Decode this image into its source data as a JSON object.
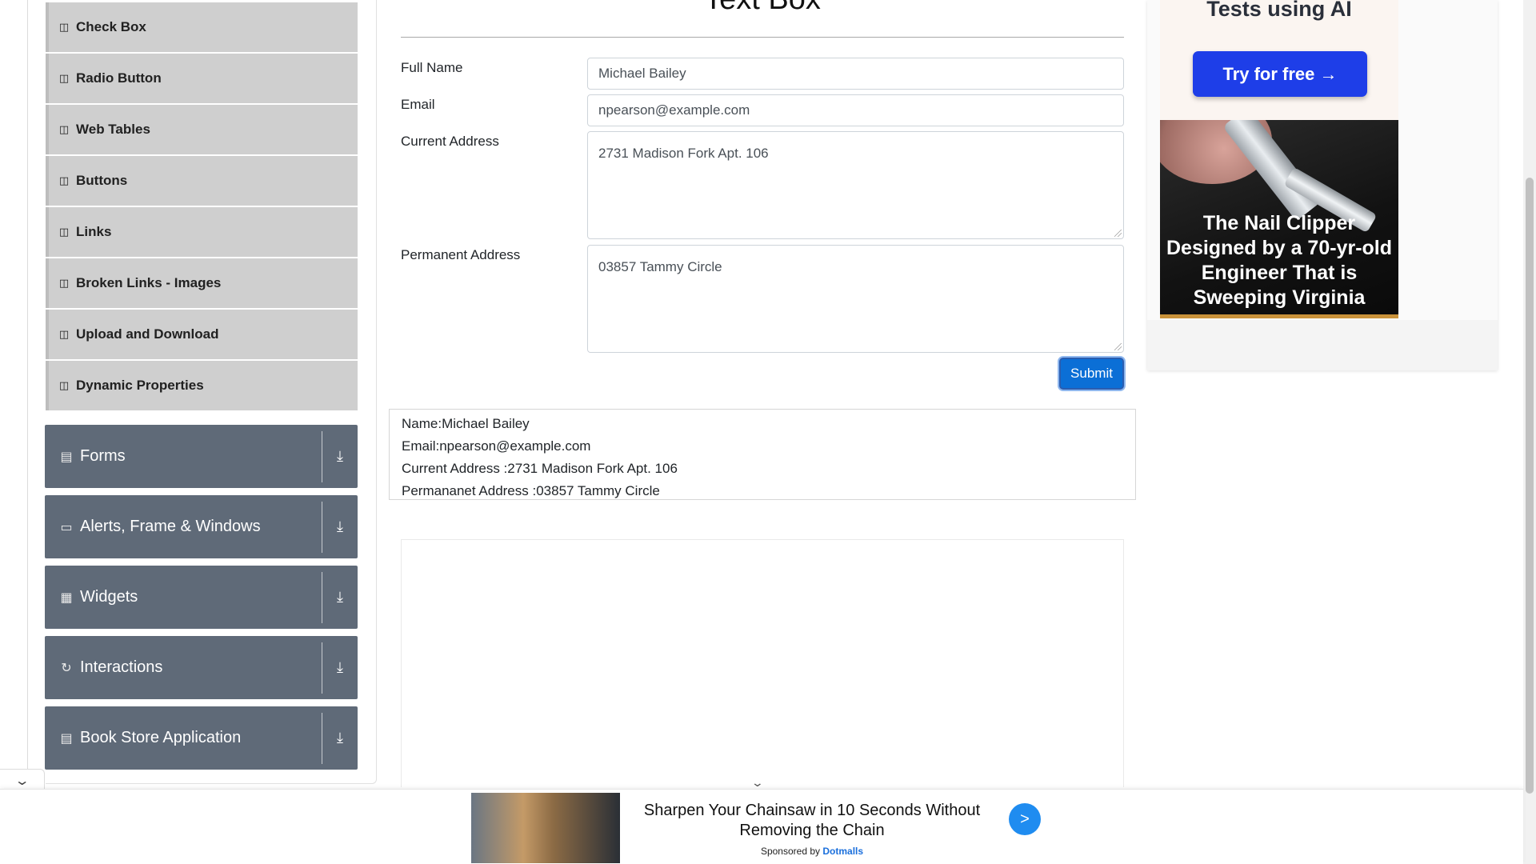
{
  "sidebar": {
    "items": [
      {
        "label": "Check Box",
        "icon": "list-icon"
      },
      {
        "label": "Radio Button",
        "icon": "list-icon"
      },
      {
        "label": "Web Tables",
        "icon": "list-icon"
      },
      {
        "label": "Buttons",
        "icon": "list-icon"
      },
      {
        "label": "Links",
        "icon": "list-icon"
      },
      {
        "label": "Broken Links - Images",
        "icon": "list-icon"
      },
      {
        "label": "Upload and Download",
        "icon": "list-icon"
      },
      {
        "label": "Dynamic Properties",
        "icon": "list-icon"
      }
    ],
    "groups": [
      {
        "label": "Forms",
        "icon": "form-icon"
      },
      {
        "label": "Alerts, Frame & Windows",
        "icon": "window-icon"
      },
      {
        "label": "Widgets",
        "icon": "widgets-icon"
      },
      {
        "label": "Interactions",
        "icon": "interactions-icon"
      },
      {
        "label": "Book Store Application",
        "icon": "books-icon"
      }
    ]
  },
  "main": {
    "title": "Text Box",
    "form": {
      "full_name_label": "Full Name",
      "full_name_value": "Michael Bailey",
      "email_label": "Email",
      "email_value": "npearson@example.com",
      "current_address_label": "Current Address",
      "current_address_value": "2731 Madison Fork Apt. 106",
      "permanent_address_label": "Permanent Address",
      "permanent_address_value": "03857 Tammy Circle",
      "submit_label": "Submit"
    },
    "output": {
      "name": "Name:Michael Bailey",
      "email": "Email:npearson@example.com",
      "current_address": "Current Address :2731 Madison Fork Apt. 106",
      "permanent_address": "Permananet Address :03857 Tammy Circle"
    }
  },
  "ad_right": {
    "headline": "Tests using AI",
    "button": "Try for free →",
    "image_caption": "The Nail Clipper Designed by a 70-yr-old Engineer That is Sweeping Virginia"
  },
  "bottom_ad": {
    "text": "Sharpen Your Chainsaw in 10 Seconds Without Removing the Chain",
    "sponsored_prefix": "Sponsored by",
    "sponsor": "Dotmalls",
    "go_label": ">"
  },
  "colors": {
    "sidebar_item_bg": "#cfcfcf",
    "group_bg": "#5f6a78",
    "submit_bg": "#0b6fd6",
    "ad_button_bg": "#1e3ee8",
    "sponsor_link": "#1a6fdc"
  }
}
